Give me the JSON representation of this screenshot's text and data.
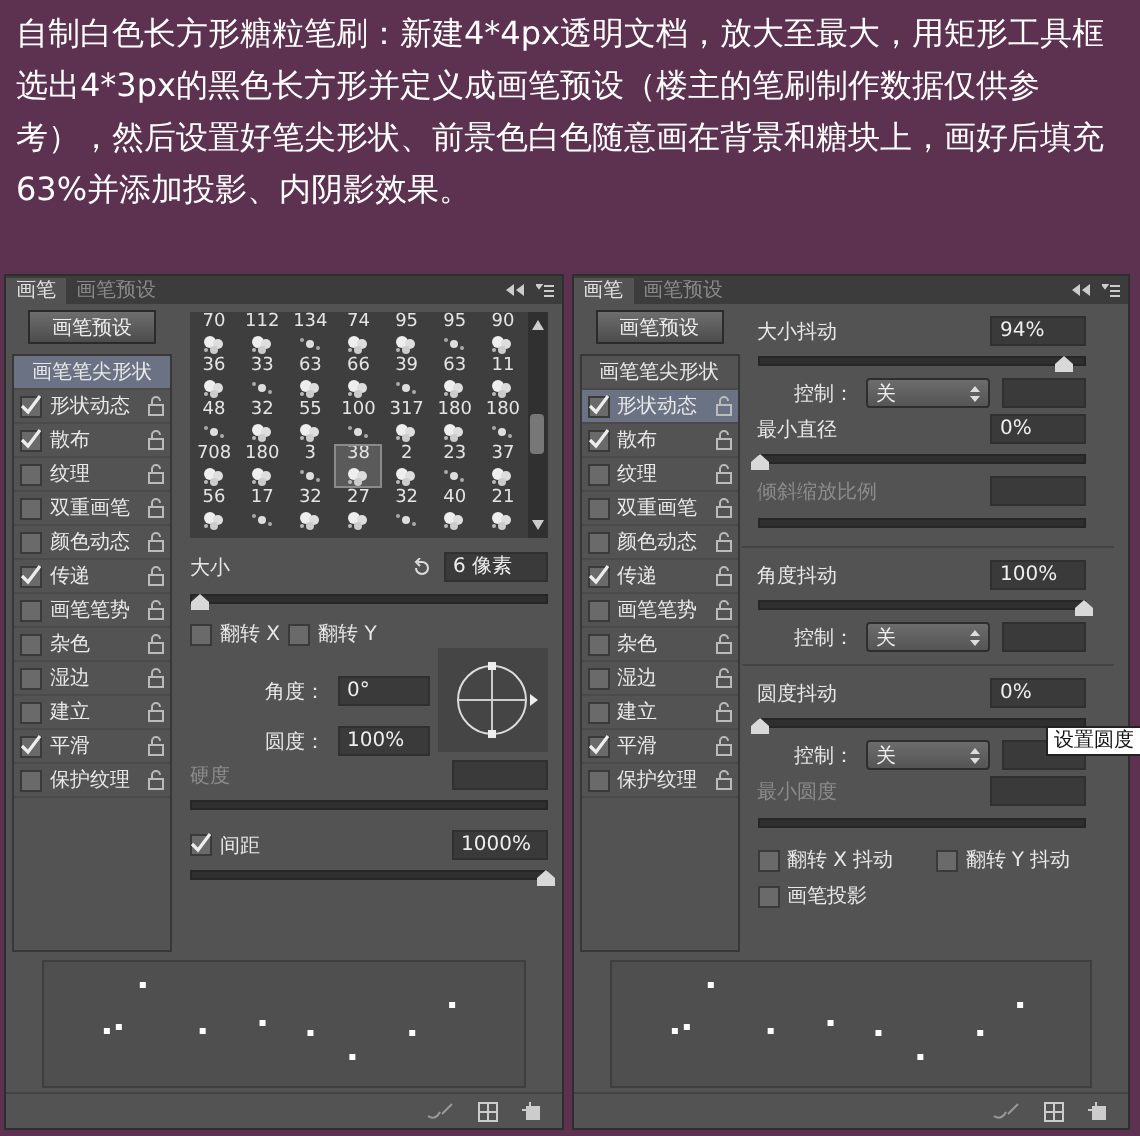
{
  "header": {
    "text": "自制白色长方形糖粒笔刷：新建4*4px透明文档，放大至最大，用矩形工具框选出4*3px的黑色长方形并定义成画笔预设（楼主的笔刷制作数据仅供参考），然后设置好笔尖形状、前景色白色随意画在背景和糖块上，画好后填充63%并添加投影、内阴影效果。"
  },
  "panels": [
    {
      "kind": "tip_shape",
      "tabs": [
        {
          "label": "画笔",
          "selected": true
        },
        {
          "label": "画笔预设",
          "selected": false
        }
      ],
      "preset_button": "画笔预设",
      "sidebar": [
        {
          "kind": "header",
          "label": "画笔笔尖形状",
          "selected": true
        },
        {
          "kind": "option",
          "label": "形状动态",
          "checked": true,
          "selected": false
        },
        {
          "kind": "option",
          "label": "散布",
          "checked": true,
          "selected": false
        },
        {
          "kind": "option",
          "label": "纹理",
          "checked": false,
          "selected": false
        },
        {
          "kind": "option",
          "label": "双重画笔",
          "checked": false,
          "selected": false
        },
        {
          "kind": "option",
          "label": "颜色动态",
          "checked": false,
          "selected": false
        },
        {
          "kind": "option",
          "label": "传递",
          "checked": true,
          "selected": false
        },
        {
          "kind": "option",
          "label": "画笔笔势",
          "checked": false,
          "selected": false
        },
        {
          "kind": "option",
          "label": "杂色",
          "checked": false,
          "selected": false
        },
        {
          "kind": "option",
          "label": "湿边",
          "checked": false,
          "selected": false
        },
        {
          "kind": "option",
          "label": "建立",
          "checked": false,
          "selected": false
        },
        {
          "kind": "option",
          "label": "平滑",
          "checked": true,
          "selected": false
        },
        {
          "kind": "option",
          "label": "保护纹理",
          "checked": false,
          "selected": false
        }
      ],
      "brush_grid": [
        {
          "size": "70",
          "selected": false
        },
        {
          "size": "112",
          "selected": false
        },
        {
          "size": "134",
          "selected": false
        },
        {
          "size": "74",
          "selected": false
        },
        {
          "size": "95",
          "selected": false
        },
        {
          "size": "95",
          "selected": false
        },
        {
          "size": "90",
          "selected": false
        },
        {
          "size": "36",
          "selected": false
        },
        {
          "size": "33",
          "selected": false
        },
        {
          "size": "63",
          "selected": false
        },
        {
          "size": "66",
          "selected": false
        },
        {
          "size": "39",
          "selected": false
        },
        {
          "size": "63",
          "selected": false
        },
        {
          "size": "11",
          "selected": false
        },
        {
          "size": "48",
          "selected": false
        },
        {
          "size": "32",
          "selected": false
        },
        {
          "size": "55",
          "selected": false
        },
        {
          "size": "100",
          "selected": false
        },
        {
          "size": "317",
          "selected": false
        },
        {
          "size": "180",
          "selected": false
        },
        {
          "size": "180",
          "selected": false
        },
        {
          "size": "708",
          "selected": false
        },
        {
          "size": "180",
          "selected": false
        },
        {
          "size": "3",
          "selected": false
        },
        {
          "size": "38",
          "selected": true
        },
        {
          "size": "2",
          "selected": false
        },
        {
          "size": "23",
          "selected": false
        },
        {
          "size": "37",
          "selected": false
        },
        {
          "size": "56",
          "selected": false
        },
        {
          "size": "17",
          "selected": false
        },
        {
          "size": "32",
          "selected": false
        },
        {
          "size": "27",
          "selected": false
        },
        {
          "size": "32",
          "selected": false
        },
        {
          "size": "40",
          "selected": false
        },
        {
          "size": "21",
          "selected": false
        }
      ],
      "size": {
        "label": "大小",
        "value": "6 像素",
        "level": 0.02
      },
      "flips": [
        {
          "label": "翻转 X",
          "checked": false
        },
        {
          "label": "翻转 Y",
          "checked": false
        }
      ],
      "angle": {
        "label": "角度：",
        "value": "0°"
      },
      "roundness": {
        "label": "圆度：",
        "value": "100%"
      },
      "hardness": {
        "label": "硬度",
        "disabled": true
      },
      "spacing": {
        "label": "间距",
        "checked": true,
        "value": "1000%",
        "level": 1
      }
    },
    {
      "kind": "shape_dynamics",
      "tabs": [
        {
          "label": "画笔",
          "selected": true
        },
        {
          "label": "画笔预设",
          "selected": false
        }
      ],
      "preset_button": "画笔预设",
      "sidebar": [
        {
          "kind": "header",
          "label": "画笔笔尖形状",
          "selected": false
        },
        {
          "kind": "option",
          "label": "形状动态",
          "checked": true,
          "selected": true
        },
        {
          "kind": "option",
          "label": "散布",
          "checked": true,
          "selected": false
        },
        {
          "kind": "option",
          "label": "纹理",
          "checked": false,
          "selected": false
        },
        {
          "kind": "option",
          "label": "双重画笔",
          "checked": false,
          "selected": false
        },
        {
          "kind": "option",
          "label": "颜色动态",
          "checked": false,
          "selected": false
        },
        {
          "kind": "option",
          "label": "传递",
          "checked": true,
          "selected": false
        },
        {
          "kind": "option",
          "label": "画笔笔势",
          "checked": false,
          "selected": false
        },
        {
          "kind": "option",
          "label": "杂色",
          "checked": false,
          "selected": false
        },
        {
          "kind": "option",
          "label": "湿边",
          "checked": false,
          "selected": false
        },
        {
          "kind": "option",
          "label": "建立",
          "checked": false,
          "selected": false
        },
        {
          "kind": "option",
          "label": "平滑",
          "checked": true,
          "selected": false
        },
        {
          "kind": "option",
          "label": "保护纹理",
          "checked": false,
          "selected": false
        }
      ],
      "rows": [
        {
          "kind": "jitter",
          "label": "大小抖动",
          "value": "94%",
          "level": 0.94
        },
        {
          "kind": "control",
          "label": "控制：",
          "value": "关"
        },
        {
          "kind": "jitter",
          "label": "最小直径",
          "value": "0%",
          "level": 0
        },
        {
          "kind": "disabled",
          "label": "倾斜缩放比例"
        },
        {
          "kind": "divider"
        },
        {
          "kind": "jitter",
          "label": "角度抖动",
          "value": "100%",
          "level": 1
        },
        {
          "kind": "control",
          "label": "控制：",
          "value": "关"
        },
        {
          "kind": "divider"
        },
        {
          "kind": "jitter",
          "label": "圆度抖动",
          "value": "0%",
          "level": 0
        },
        {
          "kind": "control",
          "label": "控制：",
          "value": "关"
        },
        {
          "kind": "disabled",
          "label": "最小圆度"
        }
      ],
      "checkboxes": [
        {
          "label": "翻转 X 抖动",
          "checked": false
        },
        {
          "label": "翻转 Y 抖动",
          "checked": false
        },
        {
          "label": "画笔投影",
          "checked": false
        }
      ],
      "tooltip": "设置圆度"
    }
  ]
}
